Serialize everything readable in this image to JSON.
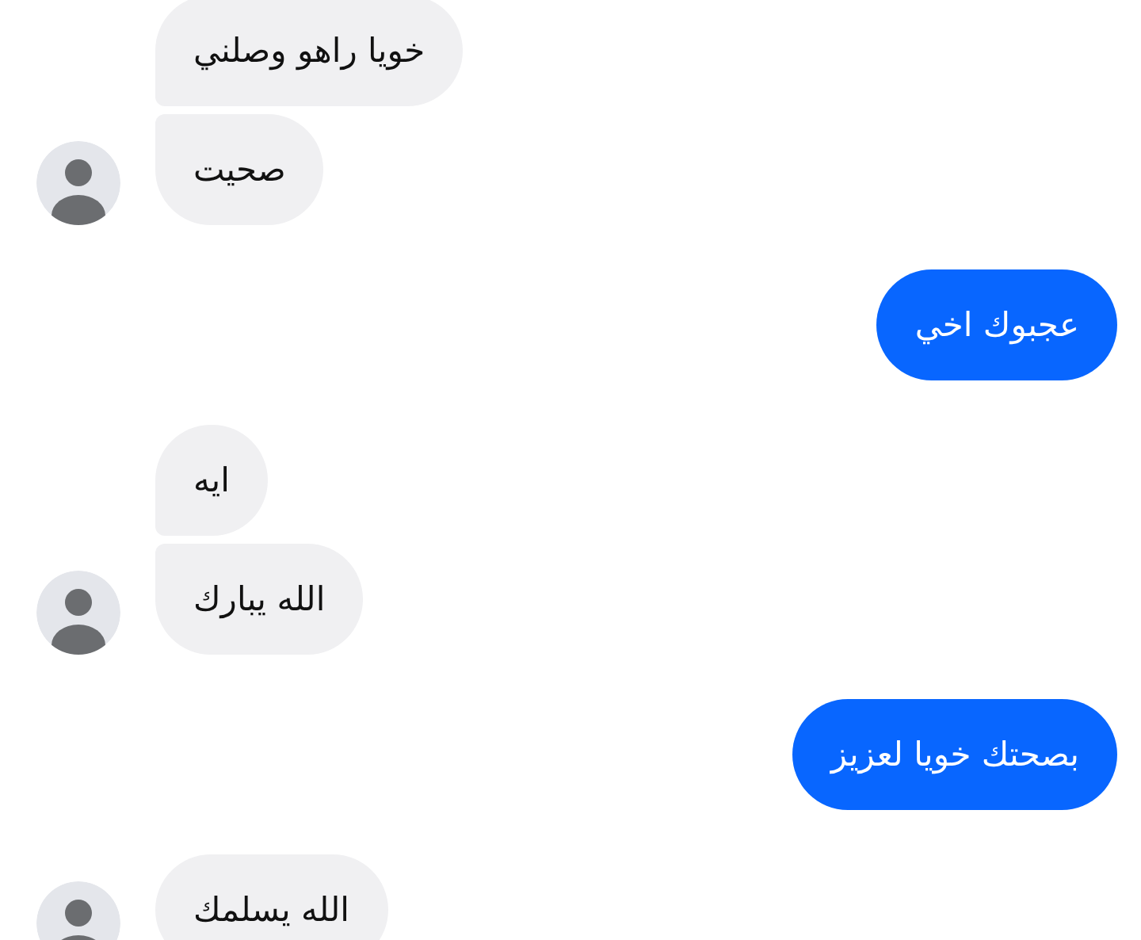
{
  "groups": [
    {
      "kind": "received",
      "messages": [
        "خويا راهو وصلني",
        "صحيت"
      ]
    },
    {
      "kind": "sent",
      "messages": [
        "عجبوك اخي"
      ]
    },
    {
      "kind": "received",
      "messages": [
        "ايه",
        "الله يبارك"
      ]
    },
    {
      "kind": "sent",
      "messages": [
        "بصحتك خويا لعزيز"
      ]
    },
    {
      "kind": "received",
      "messages": [
        "الله يسلمك"
      ]
    }
  ]
}
